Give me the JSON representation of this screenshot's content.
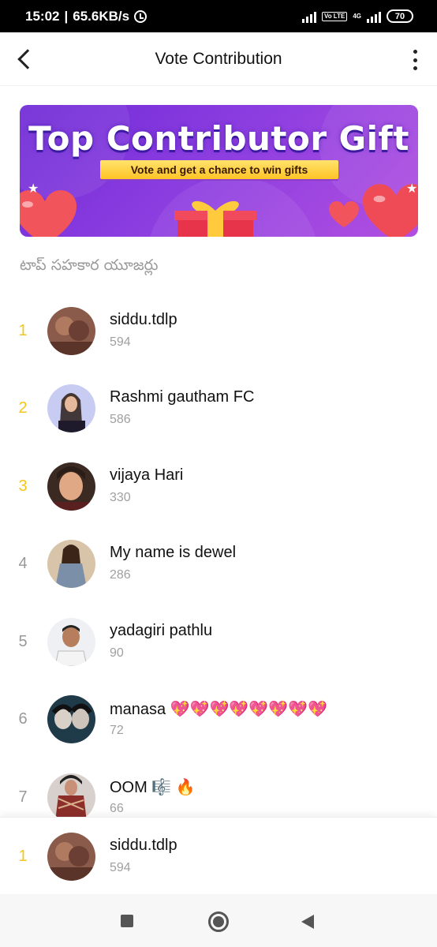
{
  "status_bar": {
    "time": "15:02",
    "speed": "65.6KB/s",
    "volte": "Vo LTE",
    "network": "4G",
    "battery": "70"
  },
  "app_bar": {
    "title": "Vote Contribution",
    "back_icon": "back-arrow-icon",
    "menu_icon": "more-vertical-icon"
  },
  "banner": {
    "title": "Top Contributor Gift",
    "subtitle": "Vote and get a chance to win gifts"
  },
  "section_label": "టాప్ సహకార యూజర్లు",
  "contributors": [
    {
      "rank": "1",
      "name": "siddu.tdlp",
      "score": "594"
    },
    {
      "rank": "2",
      "name": "Rashmi gautham FC",
      "score": "586"
    },
    {
      "rank": "3",
      "name": "vijaya Hari",
      "score": "330"
    },
    {
      "rank": "4",
      "name": "My name is dewel",
      "score": "286"
    },
    {
      "rank": "5",
      "name": "yadagiri pathlu",
      "score": "90"
    },
    {
      "rank": "6",
      "name": "manasa 💖💖💖💖💖💖💖💖",
      "score": "72"
    },
    {
      "rank": "7",
      "name": "OOM 🎼 🔥",
      "score": "66"
    }
  ],
  "self": {
    "rank": "1",
    "name": "siddu.tdlp",
    "score": "594"
  },
  "colors": {
    "gold_rank": "#f5c518",
    "grey_rank": "#999999",
    "banner_purple": "#7b33da",
    "banner_ribbon": "#ffd84a"
  },
  "nav_bar": {
    "recents_icon": "square-icon",
    "home_icon": "circle-home-icon",
    "back_icon": "triangle-back-icon"
  }
}
